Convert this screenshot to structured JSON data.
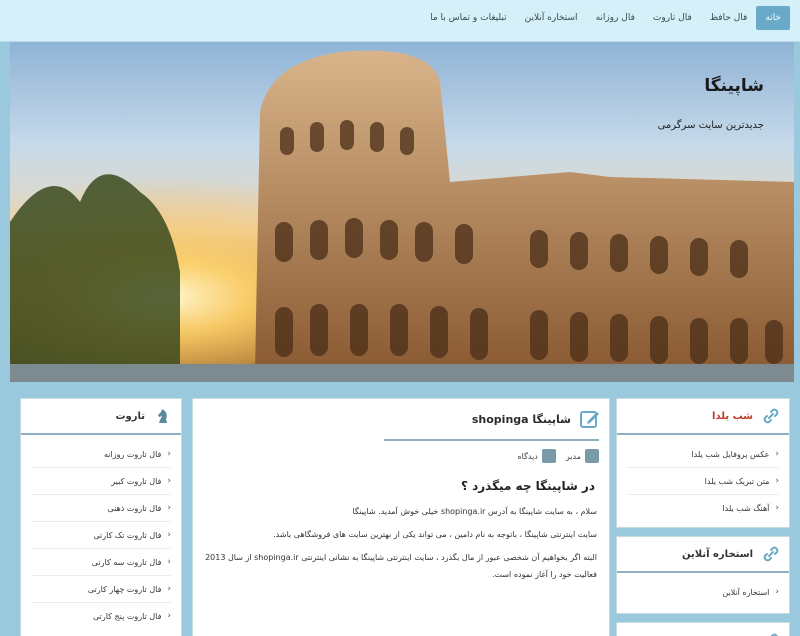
{
  "nav": {
    "items": [
      {
        "label": "خانه",
        "active": true
      },
      {
        "label": "فال حافظ",
        "active": false
      },
      {
        "label": "فال تاروت",
        "active": false
      },
      {
        "label": "فال روزانه",
        "active": false
      },
      {
        "label": "استخاره آنلاین",
        "active": false
      },
      {
        "label": "تبلیغات و تماس با ما",
        "active": false
      }
    ]
  },
  "header": {
    "title": "شاپینگا",
    "tagline": "جدیدترین سایت سرگرمی"
  },
  "right_sidebar": {
    "yalda": {
      "title": "شب یلدا",
      "items": [
        "عکس پروفایل شب یلدا",
        "متن تبریک شب یلدا",
        "آهنگ شب یلدا"
      ]
    },
    "estekhare": {
      "title": "استخاره آنلاین",
      "items": [
        "استخاره آنلاین"
      ]
    }
  },
  "main": {
    "title": "شاپینگا shopinga",
    "meta_author": "مدیر",
    "meta_category": "دیدگاه",
    "heading": "در شاپینگا چه میگذرد ؟",
    "paragraphs": [
      "سلام ، به سایت شاپینگا به آدرس shopinga.ir خیلی خوش آمدید. شاپینگا",
      "سایت اینترنتی شاپینگا ، باتوجه به نام دامین ، می تواند یکی از بهترین سایت های فروشگاهی باشد.",
      "البته اگر بخواهیم آن شخصی عبور از مال بگذرد ، سایت اینترنتی شاپینگا به نشانی اینترنتی shopinga.ir از سال 2013 فعالیت خود را آغاز نموده است."
    ]
  },
  "left_sidebar": {
    "title": "تاروت",
    "items": [
      "فال تاروت روزانه",
      "فال تاروت کبیر",
      "فال تاروت ذهنی",
      "فال تاروت تک کارتی",
      "فال تاروت سه کارتی",
      "فال تاروت چهار کارتی",
      "فال تاروت پنج کارتی"
    ]
  },
  "colors": {
    "accent": "#6aaac8",
    "yalda_title": "#c0392b",
    "background": "#9ac8dc"
  }
}
